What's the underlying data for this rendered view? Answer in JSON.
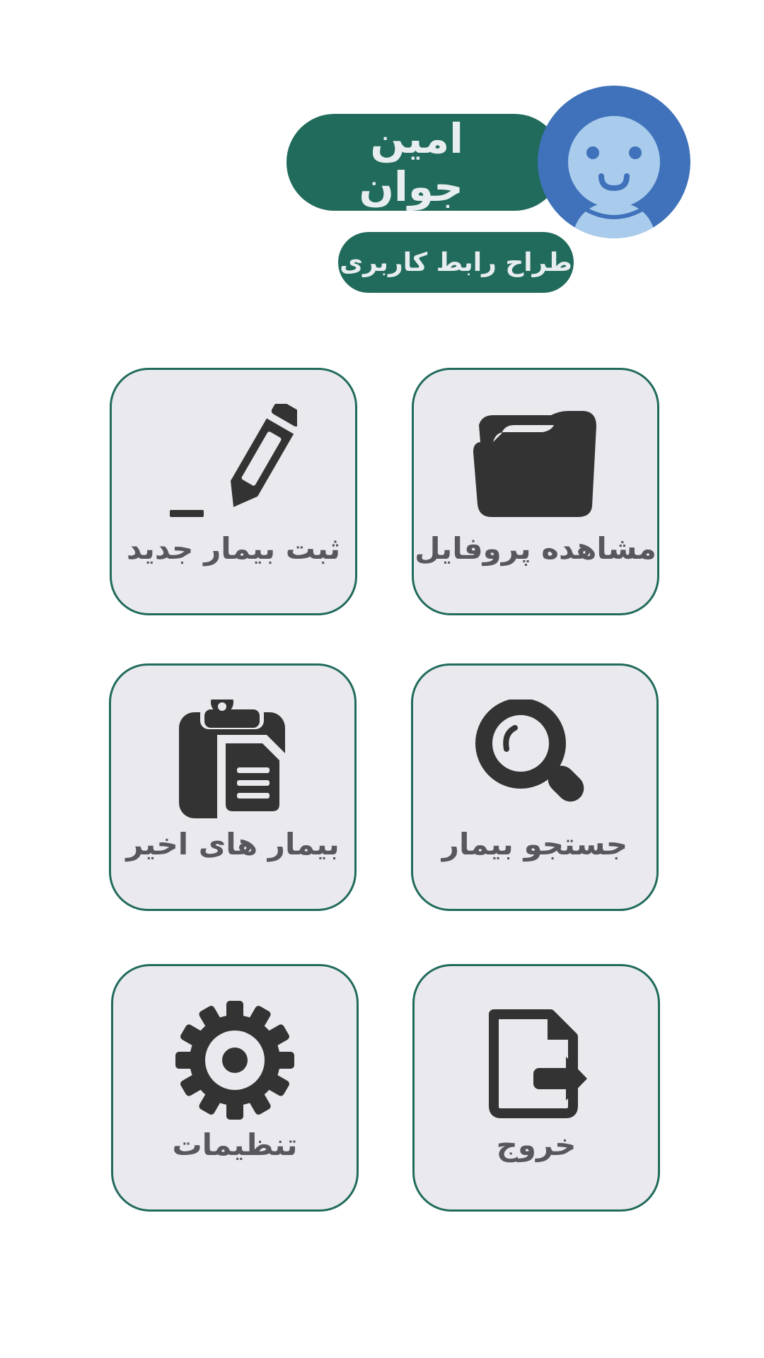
{
  "profile": {
    "name": "امین جوان",
    "role": "طراح رابط کاربری",
    "avatar_icon": "user-avatar-icon"
  },
  "colors": {
    "accent": "#216b5c",
    "tile_background": "#eaeaee",
    "icon": "#333333",
    "label": "#58585c",
    "avatar_bg": "#3f72ba",
    "avatar_face": "#a9cbec"
  },
  "menu": {
    "view_profile": {
      "label": "مشاهده پروفایل",
      "icon": "folder-icon"
    },
    "new_patient": {
      "label": "ثبت بیمار جدید",
      "icon": "pencil-icon"
    },
    "search_patient": {
      "label": "جستجو بیمار",
      "icon": "search-icon"
    },
    "recent_patients": {
      "label": "بیمار های اخیر",
      "icon": "clipboard-icon"
    },
    "logout": {
      "label": "خروج",
      "icon": "file-export-icon"
    },
    "settings": {
      "label": "تنظیمات",
      "icon": "gear-icon"
    }
  }
}
